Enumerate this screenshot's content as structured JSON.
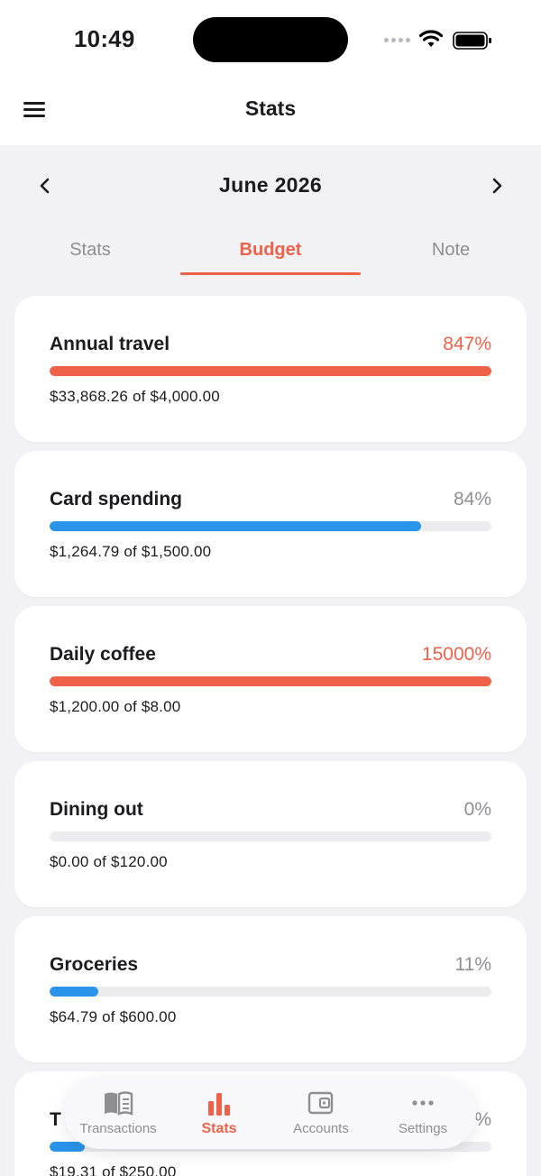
{
  "status_bar": {
    "time": "10:49"
  },
  "header": {
    "title": "Stats",
    "menu_icon": "hamburger-menu-icon"
  },
  "month_selector": {
    "label": "June 2026",
    "prev_icon": "chevron-left-icon",
    "next_icon": "chevron-right-icon"
  },
  "tabs": [
    {
      "label": "Stats",
      "active": false
    },
    {
      "label": "Budget",
      "active": true
    },
    {
      "label": "Note",
      "active": false
    }
  ],
  "colors": {
    "accent": "#f0614a",
    "progress_blue": "#2a93ea",
    "track": "#ececee"
  },
  "budgets": [
    {
      "name": "Annual travel",
      "percent_label": "847%",
      "progress": 1.0,
      "amount": "$33,868.26 of $4,000.00",
      "over": true
    },
    {
      "name": "Card spending",
      "percent_label": "84%",
      "progress": 0.84,
      "amount": "$1,264.79 of $1,500.00",
      "over": false
    },
    {
      "name": "Daily coffee",
      "percent_label": "15000%",
      "progress": 1.0,
      "amount": "$1,200.00 of $8.00",
      "over": true
    },
    {
      "name": "Dining out",
      "percent_label": "0%",
      "progress": 0.0,
      "amount": "$0.00 of $120.00",
      "over": false
    },
    {
      "name": "Groceries",
      "percent_label": "11%",
      "progress": 0.11,
      "amount": "$64.79 of $600.00",
      "over": false
    },
    {
      "name": "T",
      "percent_label": "%",
      "progress": 0.08,
      "amount": "$19.31 of $250.00",
      "over": false
    }
  ],
  "tab_bar": [
    {
      "label": "Transactions",
      "icon": "book-icon",
      "active": false
    },
    {
      "label": "Stats",
      "icon": "bar-chart-icon",
      "active": true
    },
    {
      "label": "Accounts",
      "icon": "wallet-icon",
      "active": false
    },
    {
      "label": "Settings",
      "icon": "more-dots-icon",
      "active": false
    }
  ]
}
